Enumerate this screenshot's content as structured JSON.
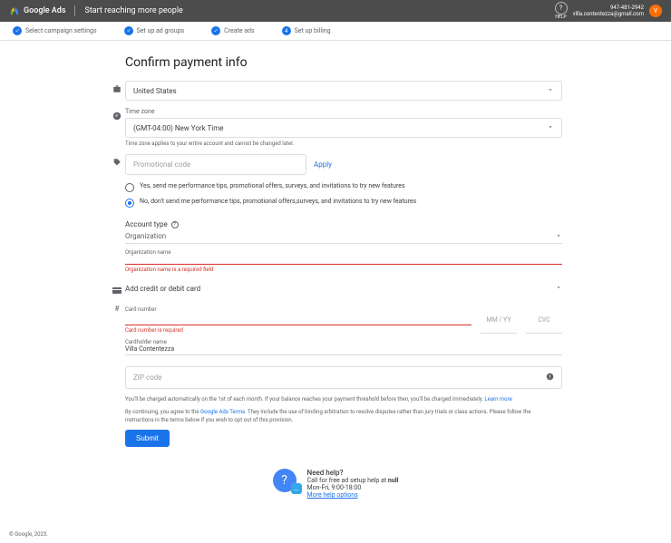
{
  "header": {
    "product": "Google Ads",
    "tagline": "Start reaching more people",
    "help_label": "HELP",
    "phone": "947-481-2942",
    "email": "villa.contentezza@gmail.com",
    "avatar_letter": "V"
  },
  "stepper": {
    "steps": [
      {
        "label": "Select campaign settings"
      },
      {
        "label": "Set up ad groups"
      },
      {
        "label": "Create ads"
      },
      {
        "label": "Set up billing"
      }
    ],
    "current_num": "4"
  },
  "title": "Confirm payment info",
  "country": {
    "value": "United States"
  },
  "timezone": {
    "label": "Time zone",
    "value": "(GMT-04:00) New York Time",
    "helper": "Time zone applies to your entire account and cannot be changed later."
  },
  "promo": {
    "placeholder": "Promotional code",
    "apply": "Apply"
  },
  "radios": {
    "yes": "Yes, send me performance tips, promotional offers, surveys, and invitations to try new features",
    "no": "No, don't send me performance tips, promotional offers,surveys, and invitations to try new features"
  },
  "account_type": {
    "label": "Account type",
    "value": "Organization"
  },
  "org_name": {
    "label": "Organization name",
    "error": "Organization name is a required field"
  },
  "card_section": {
    "label": "Add credit or debit card"
  },
  "card": {
    "num_label": "Card number",
    "num_error": "Card number is required",
    "mm_yy": "MM / YY",
    "cvc": "CVC",
    "holder_label": "Cardholder name",
    "holder_value": "Villa Contentezza",
    "zip_placeholder": "ZIP code"
  },
  "fine1": {
    "text": "You'll be charged automatically on the 1st of each month. If your balance reaches your payment threshold before then, you'll be charged immediately. ",
    "link": "Learn more"
  },
  "fine2": {
    "pre": "By continuing, you agree to the ",
    "link": "Google Ads Terms",
    "post": ". They include the use of binding arbitration to resolve disputes rather than jury trials or class actions. Please follow the instructions in the terms below if you wish to opt out of this provision."
  },
  "submit": "Submit",
  "need_help": {
    "title": "Need help?",
    "line1_pre": "Call for free ad setup help at ",
    "line1_bold": "null",
    "line2": "Mon-Fri, 9:00-18:00",
    "link": "More help options"
  },
  "footer": "© Google, 2023."
}
